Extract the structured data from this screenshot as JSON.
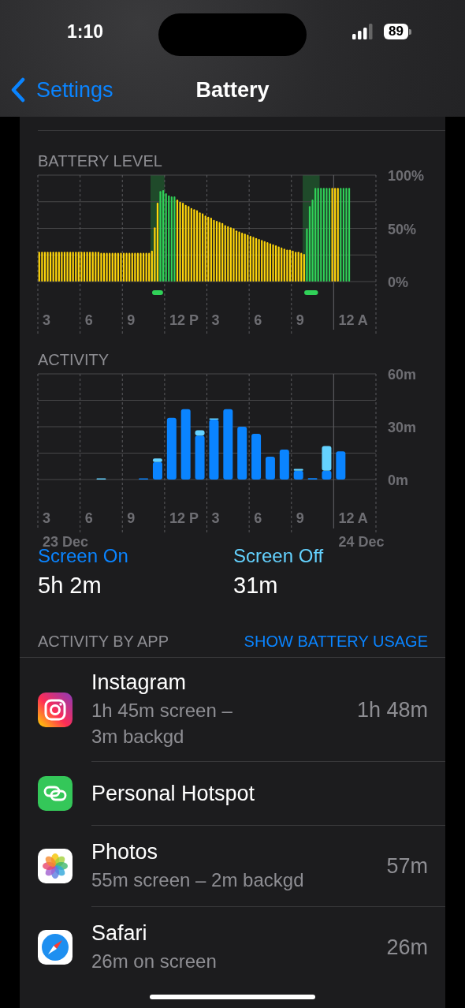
{
  "status_bar": {
    "time": "1:10",
    "battery": "89"
  },
  "nav": {
    "back": "Settings",
    "title": "Battery"
  },
  "battery_level": {
    "title": "BATTERY LEVEL",
    "hour_labels": [
      "3",
      "6",
      "9",
      "12 P",
      "3",
      "6",
      "9",
      "12 A"
    ],
    "chart_data": {
      "type": "bar",
      "ylim": [
        0,
        100
      ],
      "yticks": [
        {
          "value": 0,
          "label": "0%"
        },
        {
          "value": 50,
          "label": "50%"
        },
        {
          "value": 100,
          "label": "100%"
        }
      ],
      "series": [
        {
          "color": "#ffd60a",
          "values": [
            28,
            28,
            28,
            28,
            28,
            28,
            28,
            28,
            28,
            28,
            28,
            28,
            28,
            28,
            28,
            28,
            28,
            28,
            28,
            28,
            28,
            28,
            27,
            27,
            27,
            27,
            27,
            27,
            27,
            27,
            27,
            27,
            27,
            27,
            27,
            27,
            27,
            27,
            27,
            27,
            29,
            51,
            74,
            null,
            null,
            null,
            null,
            null,
            null,
            77,
            75,
            74,
            72,
            71,
            69,
            68,
            67,
            65,
            64,
            62,
            61,
            60,
            58,
            57,
            56,
            55,
            53,
            52,
            51,
            50,
            48,
            47,
            46,
            45,
            44,
            43,
            42,
            41,
            40,
            39,
            38,
            37,
            36,
            35,
            34,
            33,
            32,
            31,
            30,
            30,
            29,
            28,
            28,
            27,
            26,
            null,
            null,
            null,
            null,
            null,
            null,
            null,
            null,
            null,
            88,
            88,
            88,
            null,
            null,
            null,
            null,
            null,
            null,
            null,
            null,
            null,
            null,
            null,
            null,
            null
          ]
        },
        {
          "color": "#30d158",
          "values": [
            null,
            null,
            null,
            null,
            null,
            null,
            null,
            null,
            null,
            null,
            null,
            null,
            null,
            null,
            null,
            null,
            null,
            null,
            null,
            null,
            null,
            null,
            null,
            null,
            null,
            null,
            null,
            null,
            null,
            null,
            null,
            null,
            null,
            null,
            null,
            null,
            null,
            null,
            null,
            null,
            null,
            null,
            null,
            85,
            86,
            83,
            81,
            80,
            80,
            null,
            null,
            null,
            null,
            null,
            null,
            null,
            null,
            null,
            null,
            null,
            null,
            null,
            null,
            null,
            null,
            null,
            null,
            null,
            null,
            null,
            null,
            null,
            null,
            null,
            null,
            null,
            null,
            null,
            null,
            null,
            null,
            null,
            null,
            null,
            null,
            null,
            null,
            null,
            null,
            null,
            null,
            null,
            null,
            null,
            null,
            50,
            71,
            77,
            88,
            88,
            88,
            88,
            88,
            88,
            null,
            null,
            null,
            88,
            88,
            88,
            88,
            null,
            null,
            null,
            null,
            null,
            null,
            null,
            null,
            null
          ]
        }
      ]
    }
  },
  "activity": {
    "title": "ACTIVITY",
    "hour_labels": [
      "3",
      "6",
      "9",
      "12 P",
      "3",
      "6",
      "9",
      "12 A"
    ],
    "chart_data": {
      "type": "bar",
      "stacked": true,
      "ylim": [
        0,
        60
      ],
      "yticks": [
        {
          "value": 0,
          "label": "0m"
        },
        {
          "value": 30,
          "label": "30m"
        },
        {
          "value": 60,
          "label": "60m"
        }
      ],
      "series": [
        {
          "name": "Screen On",
          "color": "#0a84ff",
          "values": [
            0,
            0,
            0,
            0,
            0,
            0,
            0,
            0.6,
            10,
            35,
            40,
            25,
            34,
            40,
            30,
            26,
            13,
            17,
            5,
            0.8,
            5,
            16,
            null,
            null
          ]
        },
        {
          "name": "Screen Off",
          "color": "#64d2ff",
          "values": [
            0,
            0,
            0,
            0,
            0.6,
            0,
            0,
            0,
            2,
            0,
            0,
            3,
            0.6,
            0,
            0,
            0,
            0,
            0,
            1,
            0,
            14,
            0,
            null,
            null
          ]
        }
      ]
    },
    "dates": [
      "23 Dec",
      "24 Dec"
    ]
  },
  "screen_time": [
    "5h 2m",
    "31m"
  ],
  "apps_header": {
    "title": "ACTIVITY BY APP",
    "action": "SHOW BATTERY USAGE"
  },
  "apps": [
    {
      "kind": "instagram",
      "name": "Instagram",
      "detail": "1h 45m screen –\n3m backgd",
      "value": "1h 48m"
    },
    {
      "kind": "hotspot",
      "name": "Personal Hotspot"
    },
    {
      "kind": "photos",
      "name": "Photos",
      "detail": "55m screen – 2m backgd",
      "value": "57m"
    },
    {
      "kind": "safari",
      "name": "Safari",
      "detail": "26m on screen",
      "value": "26m"
    }
  ]
}
